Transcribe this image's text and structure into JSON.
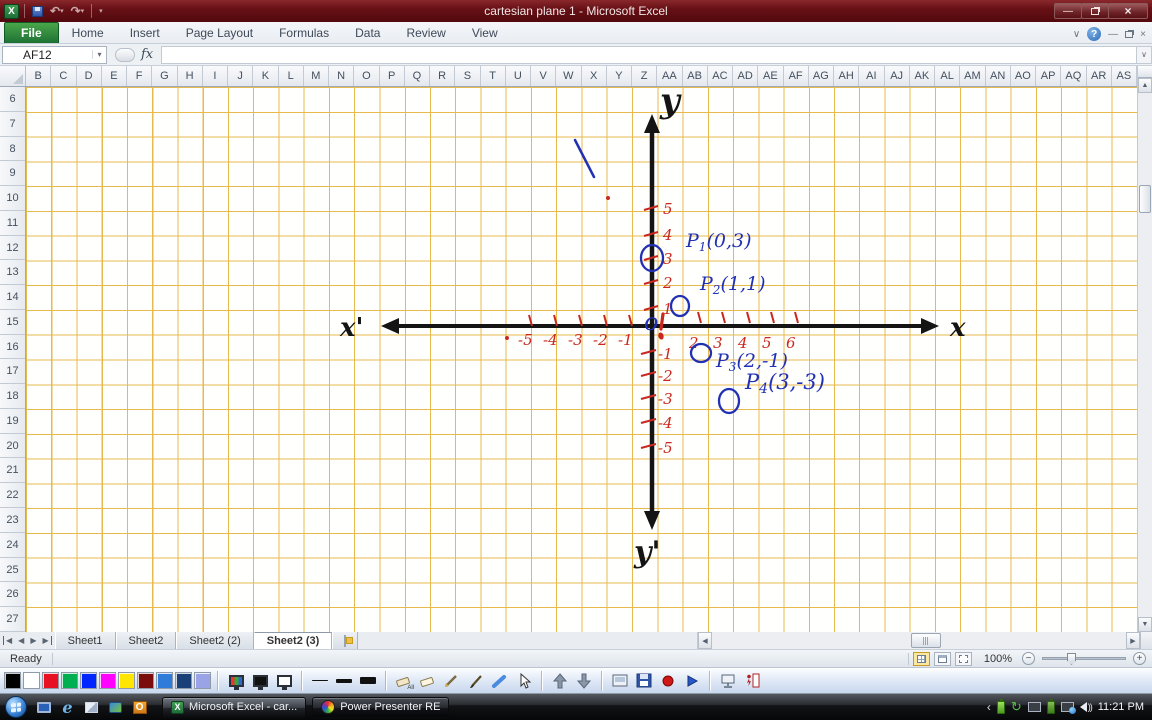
{
  "window": {
    "title": "cartesian plane 1  -  Microsoft Excel"
  },
  "icons": {
    "close": "×",
    "minimize": "—",
    "dropdown": "▾",
    "expand": "∨",
    "help": "?",
    "undo": "↶",
    "redo": "↷",
    "up": "▲",
    "down": "▼",
    "left": "◀",
    "right": "▶",
    "first": "◀",
    "last": "▶",
    "chevron_left": "‹",
    "refresh": "↻",
    "ie_letter": "e",
    "outlook_letter": "O",
    "excel_letter": "X",
    "zoom_minus": "−",
    "zoom_plus": "+"
  },
  "ribbon": {
    "tabs": [
      "File",
      "Home",
      "Insert",
      "Page Layout",
      "Formulas",
      "Data",
      "Review",
      "View"
    ],
    "active_tab": "File"
  },
  "formula_bar": {
    "name_box": "AF12",
    "fx_label": "fx",
    "formula_value": ""
  },
  "grid": {
    "columns": [
      "B",
      "C",
      "D",
      "E",
      "F",
      "G",
      "H",
      "I",
      "J",
      "K",
      "L",
      "M",
      "N",
      "O",
      "P",
      "Q",
      "R",
      "S",
      "T",
      "U",
      "V",
      "W",
      "X",
      "Y",
      "Z",
      "AA",
      "AB",
      "AC",
      "AD",
      "AE",
      "AF",
      "AG",
      "AH",
      "AI",
      "AJ",
      "AK",
      "AL",
      "AM",
      "AN",
      "AO",
      "AP",
      "AQ",
      "AR",
      "AS"
    ],
    "rows": [
      "6",
      "7",
      "8",
      "9",
      "10",
      "11",
      "12",
      "13",
      "14",
      "15",
      "16",
      "17",
      "18",
      "19",
      "20",
      "21",
      "22",
      "23",
      "24",
      "25",
      "26",
      "27"
    ],
    "gridline_color": "#e8ba4e"
  },
  "sheets": {
    "tabs": [
      "Sheet1",
      "Sheet2",
      "Sheet2 (2)",
      "Sheet2 (3)"
    ],
    "active": "Sheet2 (3)"
  },
  "status_bar": {
    "mode": "Ready",
    "zoom_level": "100%"
  },
  "drawing": {
    "axis_labels": {
      "top": "y",
      "bottom": "y'",
      "left": "x'",
      "right": "x"
    },
    "origin_label": "o",
    "y_ticks_positive": [
      "5",
      "4",
      "3",
      "2",
      "1"
    ],
    "y_ticks_negative": [
      "-1",
      "-2",
      "-3",
      "-4",
      "-5"
    ],
    "x_ticks_negative": [
      "-5",
      "-4",
      "-3",
      "-2",
      "-1"
    ],
    "x_ticks_positive": [
      "2",
      "3",
      "4",
      "5",
      "6"
    ],
    "points": [
      {
        "p": "P",
        "sub": "1",
        "coords": "(0,3)",
        "gx": 0,
        "gy": 3
      },
      {
        "p": "P",
        "sub": "2",
        "coords": "(1,1)",
        "gx": 1,
        "gy": 1
      },
      {
        "p": "P",
        "sub": "3",
        "coords": "(2,-1)",
        "gx": 2,
        "gy": -1
      },
      {
        "p": "P",
        "sub": "4",
        "coords": "(3,-3)",
        "gx": 3,
        "gy": -3
      }
    ],
    "ink": {
      "axis": "#141414",
      "tick": "#c9281e",
      "point": "#2231b4"
    }
  },
  "paint_toolbar": {
    "colors": [
      "#000000",
      "#ffffff",
      "#e81123",
      "#00b050",
      "#0026ff",
      "#ff00ff",
      "#ffe600",
      "#7b0c0c",
      "#2f7bd9",
      "#1b3f77",
      "#9aa3e6"
    ],
    "eraser_all_label": "All"
  },
  "taskbar": {
    "buttons": [
      {
        "label": "Microsoft Excel - car...",
        "active": true
      },
      {
        "label": "Power Presenter RE",
        "active": false
      }
    ],
    "clock": "11:21 PM"
  }
}
